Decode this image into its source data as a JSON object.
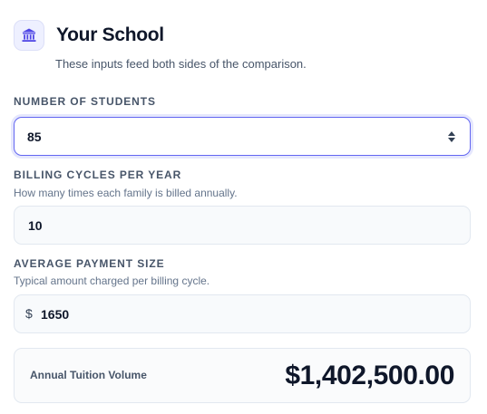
{
  "header": {
    "icon": "bank-icon",
    "title": "Your School",
    "subtitle": "These inputs feed both sides of the comparison."
  },
  "students": {
    "label": "NUMBER OF STUDENTS",
    "value": "85"
  },
  "billing_cycles": {
    "label": "BILLING CYCLES PER YEAR",
    "help": "How many times each family is billed annually.",
    "value": "10"
  },
  "payment_size": {
    "label": "AVERAGE PAYMENT SIZE",
    "help": "Typical amount charged per billing cycle.",
    "prefix": "$",
    "value": "1650"
  },
  "summary": {
    "label": "Annual Tuition Volume",
    "value": "$1,402,500.00"
  },
  "colors": {
    "accent": "#6366f1",
    "text_primary": "#0f172a",
    "text_muted": "#475569",
    "border": "#e2e8f0"
  }
}
